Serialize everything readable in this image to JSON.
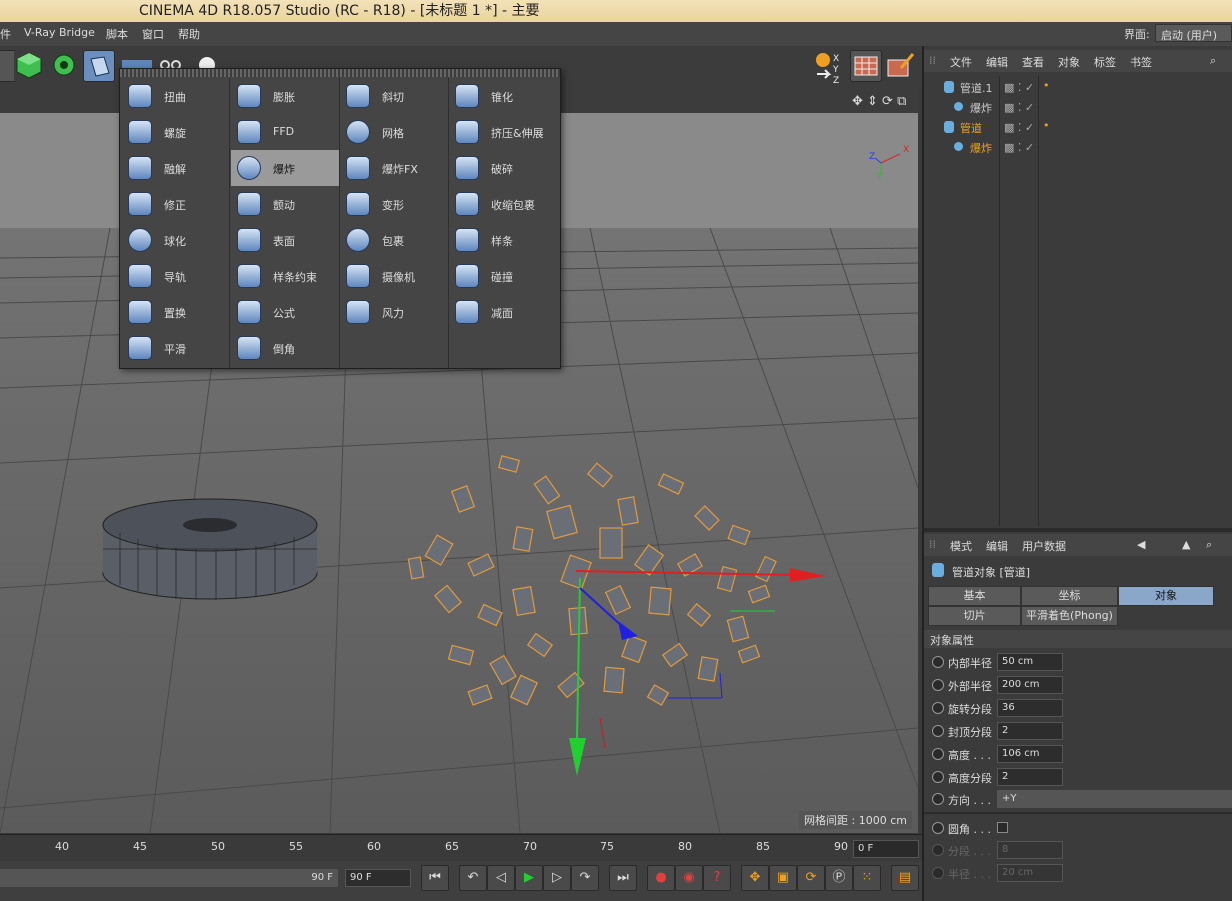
{
  "title": "CINEMA 4D R18.057 Studio (RC - R18) - [未标题 1 *] - 主要",
  "menubar": [
    "件",
    "V-Ray Bridge",
    "脚本",
    "窗口",
    "帮助"
  ],
  "layout_label": "界面:",
  "layout_value": "启动 (用户)",
  "popup": {
    "columns": [
      [
        "扭曲",
        "螺旋",
        "融解",
        "修正",
        "球化",
        "导轨",
        "置换",
        "平滑"
      ],
      [
        "膨胀",
        "FFD",
        "爆炸",
        "颤动",
        "表面",
        "样条约束",
        "公式",
        "倒角"
      ],
      [
        "斜切",
        "网格",
        "爆炸FX",
        "变形",
        "包裹",
        "摄像机",
        "风力"
      ],
      [
        "锥化",
        "挤压&伸展",
        "破碎",
        "收缩包裹",
        "样条",
        "碰撞",
        "减面"
      ]
    ],
    "selected": "爆炸"
  },
  "viewport": {
    "grid_spacing": "网格间距 : 1000 cm",
    "axis_labels": {
      "x": "X",
      "y": "Y",
      "z": "Z"
    }
  },
  "timeline": {
    "ticks": [
      "40",
      "45",
      "50",
      "55",
      "60",
      "65",
      "70",
      "75",
      "80",
      "85",
      "90"
    ],
    "current_frame": "0 F",
    "end_frame_a": "90 F",
    "end_frame_b": "90 F"
  },
  "object_manager": {
    "menu": [
      "文件",
      "编辑",
      "查看",
      "对象",
      "标签",
      "书签"
    ],
    "rows": [
      {
        "name": "管道.1",
        "indent": 0,
        "color": "#dddddd"
      },
      {
        "name": "爆炸",
        "indent": 1,
        "color": "#dddddd"
      },
      {
        "name": "管道",
        "indent": 0,
        "color": "#f0a020"
      },
      {
        "name": "爆炸",
        "indent": 1,
        "color": "#f0a020"
      }
    ]
  },
  "attributes": {
    "menu": [
      "模式",
      "编辑",
      "用户数据"
    ],
    "object_title": "管道对象 [管道]",
    "tabs_row1": [
      "基本",
      "坐标",
      "对象"
    ],
    "tabs_row2": [
      "切片",
      "平滑着色(Phong)"
    ],
    "active_tab": "对象",
    "section": "对象属性",
    "props": [
      {
        "label": "内部半径",
        "value": "50 cm"
      },
      {
        "label": "外部半径",
        "value": "200 cm"
      },
      {
        "label": "旋转分段",
        "value": "36"
      },
      {
        "label": "封顶分段",
        "value": "2"
      },
      {
        "label": "高度 . . .",
        "value": "106 cm"
      },
      {
        "label": "高度分段",
        "value": "2"
      },
      {
        "label": "方向 . . .",
        "value": "+Y"
      }
    ],
    "props2": [
      {
        "label": "圆角 . . .",
        "value": ""
      },
      {
        "label": "分段 . . .",
        "value": "8"
      },
      {
        "label": "半径 . . .",
        "value": "20 cm"
      }
    ]
  },
  "colors": {
    "accent": "#8aa6c9",
    "selection_orange": "#f0a020",
    "title_bar": "#f0dcab"
  }
}
